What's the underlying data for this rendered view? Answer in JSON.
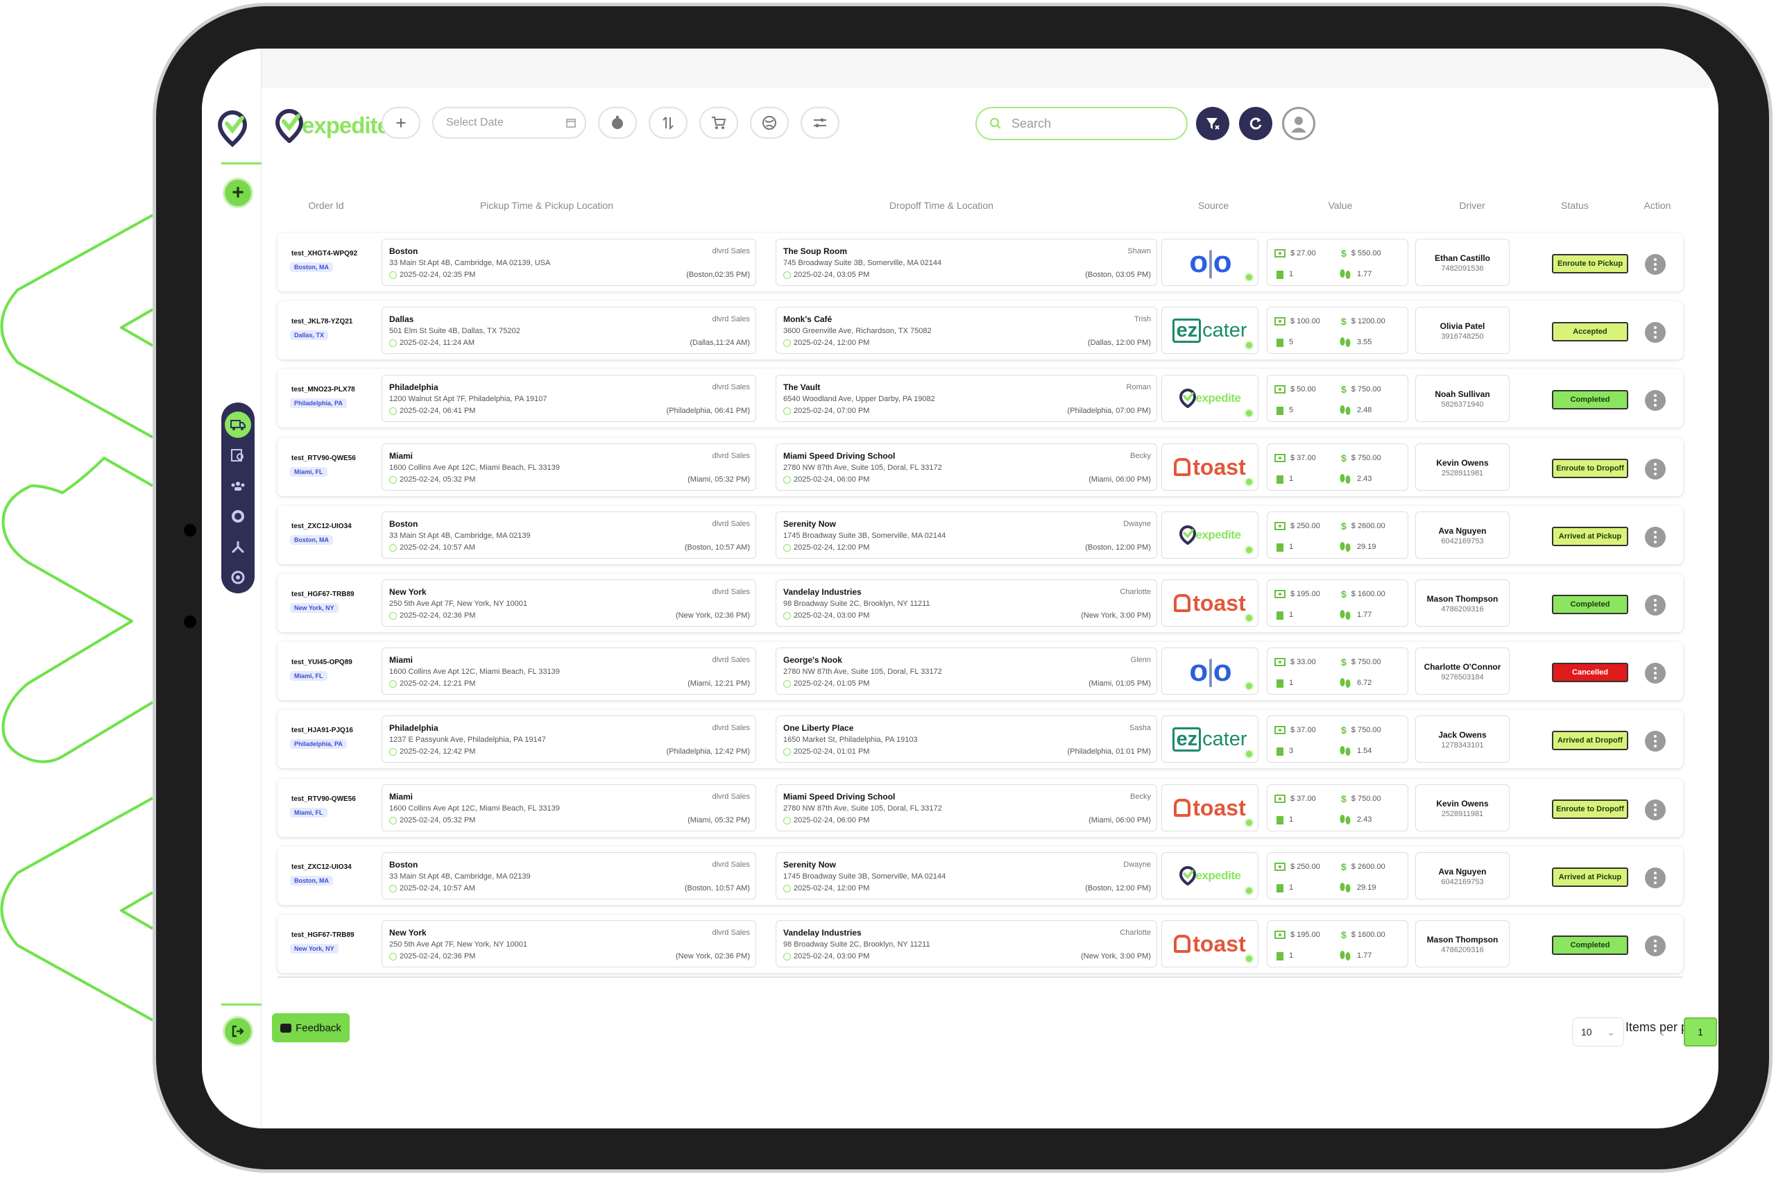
{
  "app": {
    "brand": "expedite"
  },
  "toolbar": {
    "date_placeholder": "Select Date"
  },
  "search": {
    "placeholder": "Search"
  },
  "columns": [
    "Order Id",
    "Pickup Time & Pickup Location",
    "Dropoff Time & Location",
    "Source",
    "Value",
    "Driver",
    "Status",
    "Action"
  ],
  "colors": {
    "accent": "#8ce55f",
    "nav": "#2f2e57",
    "cancelled": "#e01b1b",
    "olo": "#2b5fe0",
    "ezcater": "#1d8a6a",
    "toast": "#e2573a"
  },
  "orders": [
    {
      "id": "test_XHGT4-WPQ92",
      "tag": "Boston, MA",
      "pickup": {
        "city": "Boston",
        "sub": "dlvrd Sales",
        "addr": "33 Main St Apt 4B, Cambridge, MA 02139, USA",
        "time": "2025-02-24, 02:35 PM",
        "local": "(Boston,02:35 PM)"
      },
      "dropoff": {
        "name": "The Soup Room",
        "sub": "Shawn",
        "addr": "745 Broadway Suite 3B, Somerville, MA 02144",
        "time": "2025-02-24, 03:05 PM",
        "local": "(Boston, 03:05 PM)"
      },
      "source": "olo",
      "value": {
        "a": "$ 27.00",
        "b": "$ 550.00",
        "c": "1",
        "d": "1.77"
      },
      "driver": {
        "name": "Ethan Castillo",
        "phone": "7482091536"
      },
      "status": "Enroute to Pickup",
      "status_color": "#d9f37a"
    },
    {
      "id": "test_JKL78-YZQ21",
      "tag": "Dallas, TX",
      "pickup": {
        "city": "Dallas",
        "sub": "dlvrd Sales",
        "addr": "501 Elm St Suite 4B, Dallas, TX 75202",
        "time": "2025-02-24, 11:24 AM",
        "local": "(Dallas,11:24 AM)"
      },
      "dropoff": {
        "name": "Monk's Café",
        "sub": "Trish",
        "addr": "3600 Greenville Ave, Richardson, TX 75082",
        "time": "2025-02-24, 12:00 PM",
        "local": "(Dallas, 12:00 PM)"
      },
      "source": "ezcater",
      "value": {
        "a": "$ 100.00",
        "b": "$ 1200.00",
        "c": "5",
        "d": "3.55"
      },
      "driver": {
        "name": "Olivia Patel",
        "phone": "3916748250"
      },
      "status": "Accepted",
      "status_color": "#d9f37a"
    },
    {
      "id": "test_MNO23-PLX78",
      "tag": "Philadelphia, PA",
      "pickup": {
        "city": "Philadelphia",
        "sub": "dlvrd Sales",
        "addr": "1200 Walnut St Apt 7F, Philadelphia, PA 19107",
        "time": "2025-02-24, 06:41 PM",
        "local": "(Philadelphia, 06:41 PM)"
      },
      "dropoff": {
        "name": "The Vault",
        "sub": "Roman",
        "addr": "6540 Woodland Ave, Upper Darby, PA 19082",
        "time": "2025-02-24, 07:00 PM",
        "local": "(Philadelphia, 07:00 PM)"
      },
      "source": "expedite",
      "value": {
        "a": "$ 50.00",
        "b": "$ 750.00",
        "c": "5",
        "d": "2.48"
      },
      "driver": {
        "name": "Noah Sullivan",
        "phone": "5826371940"
      },
      "status": "Completed",
      "status_color": "#8ce55f"
    },
    {
      "id": "test_RTV90-QWE56",
      "tag": "Miami, FL",
      "pickup": {
        "city": "Miami",
        "sub": "dlvrd Sales",
        "addr": "1600 Collins Ave Apt 12C, Miami Beach, FL 33139",
        "time": "2025-02-24, 05:32 PM",
        "local": "(Miami, 05:32 PM)"
      },
      "dropoff": {
        "name": "Miami Speed Driving School",
        "sub": "Becky",
        "addr": "2780 NW 87th Ave, Suite 105, Doral, FL 33172",
        "time": "2025-02-24, 06:00 PM",
        "local": "(Miami, 06:00 PM)"
      },
      "source": "toast",
      "value": {
        "a": "$ 37.00",
        "b": "$ 750.00",
        "c": "1",
        "d": "2.43"
      },
      "driver": {
        "name": "Kevin Owens",
        "phone": "2528911981"
      },
      "status": "Enroute to Dropoff",
      "status_color": "#d9f37a"
    },
    {
      "id": "test_ZXC12-UIO34",
      "tag": "Boston, MA",
      "pickup": {
        "city": "Boston",
        "sub": "dlvrd Sales",
        "addr": "33 Main St Apt 4B, Cambridge, MA 02139",
        "time": "2025-02-24, 10:57 AM",
        "local": "(Boston, 10:57 AM)"
      },
      "dropoff": {
        "name": "Serenity Now",
        "sub": "Dwayne",
        "addr": "1745 Broadway Suite 3B, Somerville, MA 02144",
        "time": "2025-02-24, 12:00 PM",
        "local": "(Boston, 12:00 PM)"
      },
      "source": "expedite",
      "value": {
        "a": "$ 250.00",
        "b": "$ 2600.00",
        "c": "1",
        "d": "29.19"
      },
      "driver": {
        "name": "Ava Nguyen",
        "phone": "6042169753"
      },
      "status": "Arrived at Pickup",
      "status_color": "#d9f37a"
    },
    {
      "id": "test_HGF67-TRB89",
      "tag": "New York, NY",
      "pickup": {
        "city": "New York",
        "sub": "dlvrd Sales",
        "addr": "250 5th Ave Apt 7F, New York, NY 10001",
        "time": "2025-02-24, 02:36 PM",
        "local": "(New York, 02:36 PM)"
      },
      "dropoff": {
        "name": "Vandelay Industries",
        "sub": "Charlotte",
        "addr": "98 Broadway Suite 2C, Brooklyn, NY 11211",
        "time": "2025-02-24, 03:00 PM",
        "local": "(New York, 3:00 PM)"
      },
      "source": "toast",
      "value": {
        "a": "$ 195.00",
        "b": "$ 1600.00",
        "c": "1",
        "d": "1.77"
      },
      "driver": {
        "name": "Mason Thompson",
        "phone": "4786209316"
      },
      "status": "Completed",
      "status_color": "#8ce55f"
    },
    {
      "id": "test_YUI45-OPQ89",
      "tag": "Miami, FL",
      "pickup": {
        "city": "Miami",
        "sub": "dlvrd Sales",
        "addr": "1600 Collins Ave Apt 12C, Miami Beach, FL 33139",
        "time": "2025-02-24, 12:21 PM",
        "local": "(Miami, 12:21 PM)"
      },
      "dropoff": {
        "name": "George's Nook",
        "sub": "Glenn",
        "addr": "2780 NW 87th Ave, Suite 105, Doral, FL 33172",
        "time": "2025-02-24, 01:05 PM",
        "local": "(Miami, 01:05 PM)"
      },
      "source": "olo",
      "value": {
        "a": "$ 33.00",
        "b": "$ 750.00",
        "c": "1",
        "d": "6.72"
      },
      "driver": {
        "name": "Charlotte O'Connor",
        "phone": "9276503184"
      },
      "status": "Cancelled",
      "status_color": "#e01b1b"
    },
    {
      "id": "test_HJA91-PJQ16",
      "tag": "Philadelphia, PA",
      "pickup": {
        "city": "Philadelphia",
        "sub": "dlvrd Sales",
        "addr": "1237 E Passyunk Ave, Philadelphia, PA 19147",
        "time": "2025-02-24, 12:42 PM",
        "local": "(Philadelphia, 12:42 PM)"
      },
      "dropoff": {
        "name": "One Liberty Place",
        "sub": "Sasha",
        "addr": "1650 Market St, Philadelphia, PA 19103",
        "time": "2025-02-24, 01:01 PM",
        "local": "(Philadelphia, 01:01 PM)"
      },
      "source": "ezcater",
      "value": {
        "a": "$ 37.00",
        "b": "$ 750.00",
        "c": "3",
        "d": "1.54"
      },
      "driver": {
        "name": "Jack Owens",
        "phone": "1278343101"
      },
      "status": "Arrived at Dropoff",
      "status_color": "#d9f37a"
    },
    {
      "id": "test_RTV90-QWE56",
      "tag": "Miami, FL",
      "pickup": {
        "city": "Miami",
        "sub": "dlvrd Sales",
        "addr": "1600 Collins Ave Apt 12C, Miami Beach, FL 33139",
        "time": "2025-02-24, 05:32 PM",
        "local": "(Miami, 05:32 PM)"
      },
      "dropoff": {
        "name": "Miami Speed Driving School",
        "sub": "Becky",
        "addr": "2780 NW 87th Ave, Suite 105, Doral, FL 33172",
        "time": "2025-02-24, 06:00 PM",
        "local": "(Miami, 06:00 PM)"
      },
      "source": "toast",
      "value": {
        "a": "$ 37.00",
        "b": "$ 750.00",
        "c": "1",
        "d": "2.43"
      },
      "driver": {
        "name": "Kevin Owens",
        "phone": "2528911981"
      },
      "status": "Enroute to Dropoff",
      "status_color": "#d9f37a"
    },
    {
      "id": "test_ZXC12-UIO34",
      "tag": "Boston, MA",
      "pickup": {
        "city": "Boston",
        "sub": "dlvrd Sales",
        "addr": "33 Main St Apt 4B, Cambridge, MA 02139",
        "time": "2025-02-24, 10:57 AM",
        "local": "(Boston, 10:57 AM)"
      },
      "dropoff": {
        "name": "Serenity Now",
        "sub": "Dwayne",
        "addr": "1745 Broadway Suite 3B, Somerville, MA 02144",
        "time": "2025-02-24, 12:00 PM",
        "local": "(Boston, 12:00 PM)"
      },
      "source": "expedite",
      "value": {
        "a": "$ 250.00",
        "b": "$ 2600.00",
        "c": "1",
        "d": "29.19"
      },
      "driver": {
        "name": "Ava Nguyen",
        "phone": "6042169753"
      },
      "status": "Arrived at Pickup",
      "status_color": "#d9f37a"
    },
    {
      "id": "test_HGF67-TRB89",
      "tag": "New York, NY",
      "pickup": {
        "city": "New York",
        "sub": "dlvrd Sales",
        "addr": "250 5th Ave Apt 7F, New York, NY 10001",
        "time": "2025-02-24, 02:36 PM",
        "local": "(New York, 02:36 PM)"
      },
      "dropoff": {
        "name": "Vandelay Industries",
        "sub": "Charlotte",
        "addr": "98 Broadway Suite 2C, Brooklyn, NY 11211",
        "time": "2025-02-24, 03:00 PM",
        "local": "(New York, 3:00 PM)"
      },
      "source": "toast",
      "value": {
        "a": "$ 195.00",
        "b": "$ 1600.00",
        "c": "1",
        "d": "1.77"
      },
      "driver": {
        "name": "Mason Thompson",
        "phone": "4786209316"
      },
      "status": "Completed",
      "status_color": "#8ce55f"
    }
  ],
  "footer": {
    "feedback": "Feedback",
    "items_per_page_label": "Items per page:",
    "items_per_page": "10",
    "current_page": "1"
  }
}
